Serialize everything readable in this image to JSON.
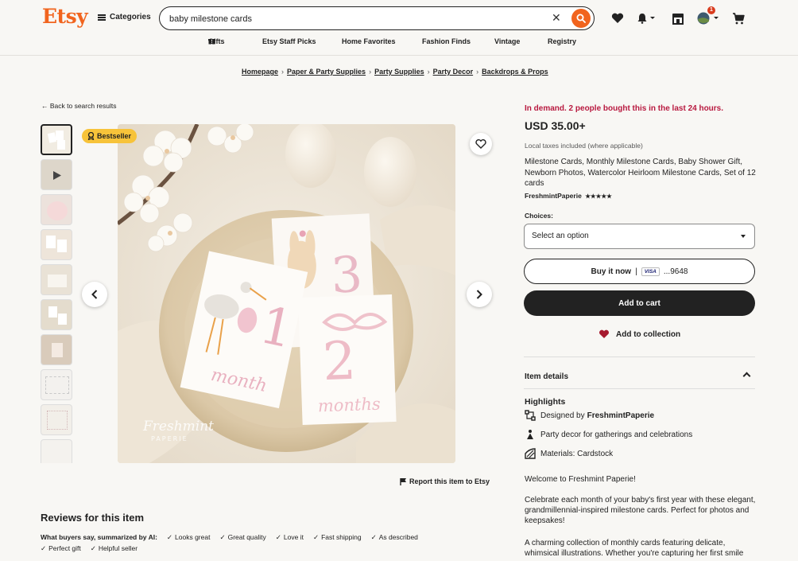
{
  "header": {
    "logo": "Etsy",
    "categories_label": "Categories",
    "search_value": "baby milestone cards",
    "cart_badge": "1"
  },
  "subnav": [
    "Gifts",
    "Etsy Staff Picks",
    "Home Favorites",
    "Fashion Finds",
    "Vintage",
    "Registry"
  ],
  "breadcrumbs": [
    "Homepage",
    "Paper & Party Supplies",
    "Party Supplies",
    "Party Decor",
    "Backdrops & Props"
  ],
  "back_link": "Back to search results",
  "gallery": {
    "badge": "Bestseller",
    "report_link": "Report this item to Etsy"
  },
  "reviews": {
    "title": "Reviews for this item",
    "summary_label": "What buyers say, summarized by AI:",
    "tags": [
      "Looks great",
      "Great quality",
      "Love it",
      "Fast shipping",
      "As described",
      "Perfect gift",
      "Helpful seller"
    ]
  },
  "listing": {
    "demand": "In demand. 2 people bought this in the last 24 hours.",
    "price": "USD 35.00+",
    "tax_note": "Local taxes included (where applicable)",
    "title": "Milestone Cards, Monthly Milestone Cards, Baby Shower Gift, Newborn Photos, Watercolor Heirloom Milestone Cards, Set of 12 cards",
    "shop": "FreshmintPaperie",
    "rating": "★★★★★",
    "choices_label": "Choices:",
    "choices_value": "Select an option",
    "buy_now": "Buy it now",
    "card_brand": "VISA",
    "card_last": "...9648",
    "add_to_cart": "Add to cart",
    "add_to_collection": "Add to collection"
  },
  "details": {
    "title": "Item details",
    "highlights_title": "Highlights",
    "designed_by_prefix": "Designed by",
    "designed_by_shop": "FreshmintPaperie",
    "highlight_2": "Party decor for gatherings and celebrations",
    "highlight_3": "Materials: Cardstock",
    "desc_1": "Welcome to Freshmint Paperie!",
    "desc_2": "Celebrate each month of your baby's first year with these elegant, grandmillennial-inspired milestone cards. Perfect for photos and keepsakes!",
    "desc_3": "A charming collection of monthly cards featuring delicate, whimsical illustrations. Whether you're capturing her first smile"
  },
  "image_text": {
    "card1_number": "1",
    "card1_word": "month",
    "card3_number": "2",
    "card3_word": "months",
    "card2_number": "3",
    "watermark": "Freshmint",
    "watermark_sub": "PAPERIE"
  }
}
